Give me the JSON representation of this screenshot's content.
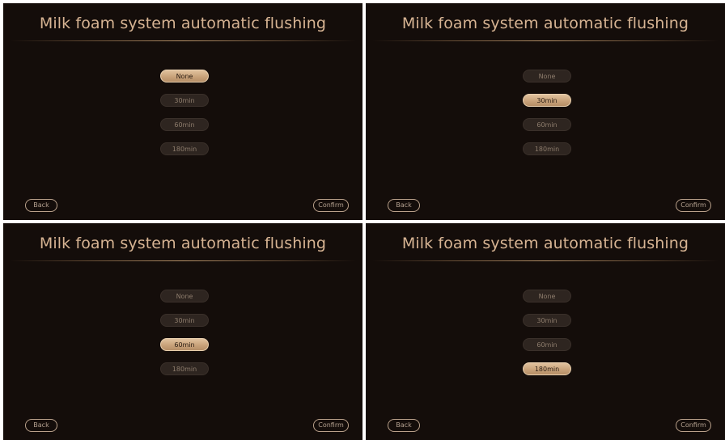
{
  "panels": [
    {
      "title": "Milk foam system automatic flushing",
      "options": [
        "None",
        "30min",
        "60min",
        "180min"
      ],
      "selected_index": 0,
      "back_label": "Back",
      "confirm_label": "Confirm"
    },
    {
      "title": "Milk foam system automatic flushing",
      "options": [
        "None",
        "30min",
        "60min",
        "180min"
      ],
      "selected_index": 1,
      "back_label": "Back",
      "confirm_label": "Confirm"
    },
    {
      "title": "Milk foam system automatic flushing",
      "options": [
        "None",
        "30min",
        "60min",
        "180min"
      ],
      "selected_index": 2,
      "back_label": "Back",
      "confirm_label": "Confirm"
    },
    {
      "title": "Milk foam system automatic flushing",
      "options": [
        "None",
        "30min",
        "60min",
        "180min"
      ],
      "selected_index": 3,
      "back_label": "Back",
      "confirm_label": "Confirm"
    }
  ],
  "colors": {
    "background": "#140d0a",
    "title": "#d7b493",
    "option_idle": "#2e2520",
    "option_selected": "#c9a37b",
    "button_outline": "#b9a08a"
  }
}
